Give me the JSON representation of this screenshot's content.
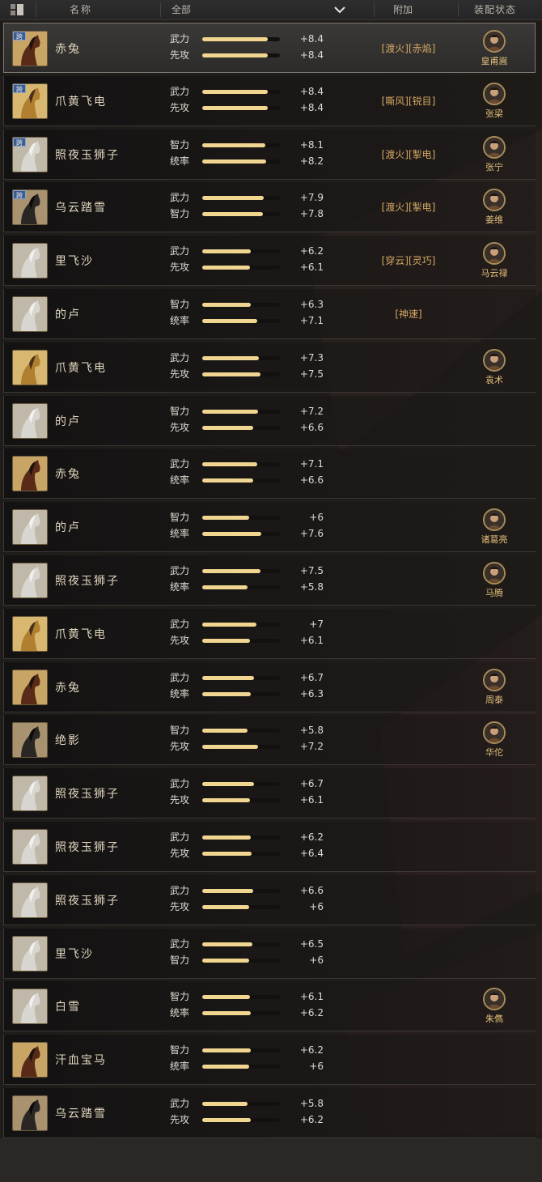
{
  "header": {
    "name_label": "名称",
    "filter_value": "全部",
    "extra_label": "附加",
    "status_label": "装配状态"
  },
  "cross_badge": "跨",
  "rows": [
    {
      "horse": "赤兔",
      "coat": "red",
      "cross": true,
      "selected": true,
      "stats": [
        {
          "label": "武力",
          "value": "+8.4",
          "fill": 0.84
        },
        {
          "label": "先攻",
          "value": "+8.4",
          "fill": 0.84
        }
      ],
      "extra": "[渡火][赤焰]",
      "general": "皇甫嵩"
    },
    {
      "horse": "爪黄飞电",
      "coat": "gold",
      "cross": true,
      "stats": [
        {
          "label": "武力",
          "value": "+8.4",
          "fill": 0.84
        },
        {
          "label": "先攻",
          "value": "+8.4",
          "fill": 0.84
        }
      ],
      "extra": "[嘶风][锐目]",
      "general": "张梁"
    },
    {
      "horse": "照夜玉狮子",
      "coat": "white",
      "cross": true,
      "stats": [
        {
          "label": "智力",
          "value": "+8.1",
          "fill": 0.81
        },
        {
          "label": "统率",
          "value": "+8.2",
          "fill": 0.82
        }
      ],
      "extra": "[渡火][掣电]",
      "general": "张宁"
    },
    {
      "horse": "乌云踏雪",
      "coat": "black",
      "cross": true,
      "stats": [
        {
          "label": "武力",
          "value": "+7.9",
          "fill": 0.79
        },
        {
          "label": "智力",
          "value": "+7.8",
          "fill": 0.78
        }
      ],
      "extra": "[渡火][掣电]",
      "general": "姜维"
    },
    {
      "horse": "里飞沙",
      "coat": "white",
      "stats": [
        {
          "label": "武力",
          "value": "+6.2",
          "fill": 0.62
        },
        {
          "label": "先攻",
          "value": "+6.1",
          "fill": 0.61
        }
      ],
      "extra": "[穿云][灵巧]",
      "general": "马云禄"
    },
    {
      "horse": "的卢",
      "coat": "white",
      "stats": [
        {
          "label": "智力",
          "value": "+6.3",
          "fill": 0.63
        },
        {
          "label": "统率",
          "value": "+7.1",
          "fill": 0.71
        }
      ],
      "extra": "[神速]",
      "general": ""
    },
    {
      "horse": "爪黄飞电",
      "coat": "gold",
      "stats": [
        {
          "label": "武力",
          "value": "+7.3",
          "fill": 0.73
        },
        {
          "label": "先攻",
          "value": "+7.5",
          "fill": 0.75
        }
      ],
      "extra": "",
      "general": "袁术"
    },
    {
      "horse": "的卢",
      "coat": "white",
      "stats": [
        {
          "label": "智力",
          "value": "+7.2",
          "fill": 0.72
        },
        {
          "label": "先攻",
          "value": "+6.6",
          "fill": 0.66
        }
      ],
      "extra": "",
      "general": ""
    },
    {
      "horse": "赤兔",
      "coat": "red",
      "stats": [
        {
          "label": "武力",
          "value": "+7.1",
          "fill": 0.71
        },
        {
          "label": "统率",
          "value": "+6.6",
          "fill": 0.66
        }
      ],
      "extra": "",
      "general": ""
    },
    {
      "horse": "的卢",
      "coat": "white",
      "stats": [
        {
          "label": "智力",
          "value": "+6",
          "fill": 0.6
        },
        {
          "label": "统率",
          "value": "+7.6",
          "fill": 0.76
        }
      ],
      "extra": "",
      "general": "诸葛亮"
    },
    {
      "horse": "照夜玉狮子",
      "coat": "white",
      "stats": [
        {
          "label": "武力",
          "value": "+7.5",
          "fill": 0.75
        },
        {
          "label": "统率",
          "value": "+5.8",
          "fill": 0.58
        }
      ],
      "extra": "",
      "general": "马腾"
    },
    {
      "horse": "爪黄飞电",
      "coat": "gold",
      "stats": [
        {
          "label": "武力",
          "value": "+7",
          "fill": 0.7
        },
        {
          "label": "先攻",
          "value": "+6.1",
          "fill": 0.61
        }
      ],
      "extra": "",
      "general": ""
    },
    {
      "horse": "赤兔",
      "coat": "red",
      "stats": [
        {
          "label": "武力",
          "value": "+6.7",
          "fill": 0.67
        },
        {
          "label": "统率",
          "value": "+6.3",
          "fill": 0.63
        }
      ],
      "extra": "",
      "general": "周泰"
    },
    {
      "horse": "绝影",
      "coat": "black",
      "stats": [
        {
          "label": "智力",
          "value": "+5.8",
          "fill": 0.58
        },
        {
          "label": "先攻",
          "value": "+7.2",
          "fill": 0.72
        }
      ],
      "extra": "",
      "general": "华佗"
    },
    {
      "horse": "照夜玉狮子",
      "coat": "white",
      "stats": [
        {
          "label": "武力",
          "value": "+6.7",
          "fill": 0.67
        },
        {
          "label": "先攻",
          "value": "+6.1",
          "fill": 0.61
        }
      ],
      "extra": "",
      "general": ""
    },
    {
      "horse": "照夜玉狮子",
      "coat": "white",
      "stats": [
        {
          "label": "武力",
          "value": "+6.2",
          "fill": 0.62
        },
        {
          "label": "先攻",
          "value": "+6.4",
          "fill": 0.64
        }
      ],
      "extra": "",
      "general": ""
    },
    {
      "horse": "照夜玉狮子",
      "coat": "white",
      "stats": [
        {
          "label": "武力",
          "value": "+6.6",
          "fill": 0.66
        },
        {
          "label": "先攻",
          "value": "+6",
          "fill": 0.6
        }
      ],
      "extra": "",
      "general": ""
    },
    {
      "horse": "里飞沙",
      "coat": "white",
      "stats": [
        {
          "label": "武力",
          "value": "+6.5",
          "fill": 0.65
        },
        {
          "label": "智力",
          "value": "+6",
          "fill": 0.6
        }
      ],
      "extra": "",
      "general": ""
    },
    {
      "horse": "白雪",
      "coat": "white",
      "stats": [
        {
          "label": "智力",
          "value": "+6.1",
          "fill": 0.61
        },
        {
          "label": "统率",
          "value": "+6.2",
          "fill": 0.62
        }
      ],
      "extra": "",
      "general": "朱儁"
    },
    {
      "horse": "汗血宝马",
      "coat": "red",
      "stats": [
        {
          "label": "智力",
          "value": "+6.2",
          "fill": 0.62
        },
        {
          "label": "统率",
          "value": "+6",
          "fill": 0.6
        }
      ],
      "extra": "",
      "general": ""
    },
    {
      "horse": "乌云踏雪",
      "coat": "black",
      "stats": [
        {
          "label": "武力",
          "value": "+5.8",
          "fill": 0.58
        },
        {
          "label": "先攻",
          "value": "+6.2",
          "fill": 0.62
        }
      ],
      "extra": "",
      "general": ""
    }
  ],
  "colors": {
    "bar_fill": "#f0d690",
    "extra_text": "#d6a863",
    "general_name": "#e3c07a",
    "coat_red": "#5a2a18",
    "coat_gold": "#b08030",
    "coat_white": "#d8d6d0",
    "coat_black": "#2a2624"
  }
}
